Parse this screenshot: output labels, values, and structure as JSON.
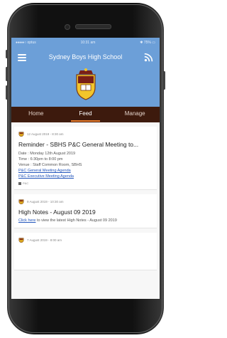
{
  "app": {
    "title": "Sydney Boys High School"
  },
  "statusbar": {
    "carrier": "●●●●○ optus",
    "time": "10:31 am",
    "battery": "✱ 75% ▭"
  },
  "tabs": [
    "Home",
    "Feed",
    "Manage"
  ],
  "active_tab": 1,
  "posts": [
    {
      "date": "12 August 2019 - 8:30 am",
      "title": "Reminder - SBHS P&C General Meeting to...",
      "lines": [
        "Date  : Monday 12th August 2019",
        "Time  : 6:30pm to 8:00 pm",
        "Venue : Staff Common Room, SBHS"
      ],
      "links": [
        "P&C General Meeting Agenda",
        "P&C Executive Meeting Agenda"
      ],
      "tag": "P&C"
    },
    {
      "date": "9 August 2019 - 10:30 am",
      "title": "High Notes - August 09 2019",
      "body_link": "Click here",
      "body_text": " to view the latest High Notes - August 09 2019"
    },
    {
      "date": "7 August 2019 - 8:00 am"
    }
  ],
  "colors": {
    "header": "#6c9fd8",
    "tabbar": "#3d1a0d",
    "tab_indicator": "#e87c2b",
    "link": "#2255bb"
  },
  "icons": {
    "menu": "hamburger-icon",
    "rss": "rss-icon",
    "post": "school-crest-icon"
  }
}
